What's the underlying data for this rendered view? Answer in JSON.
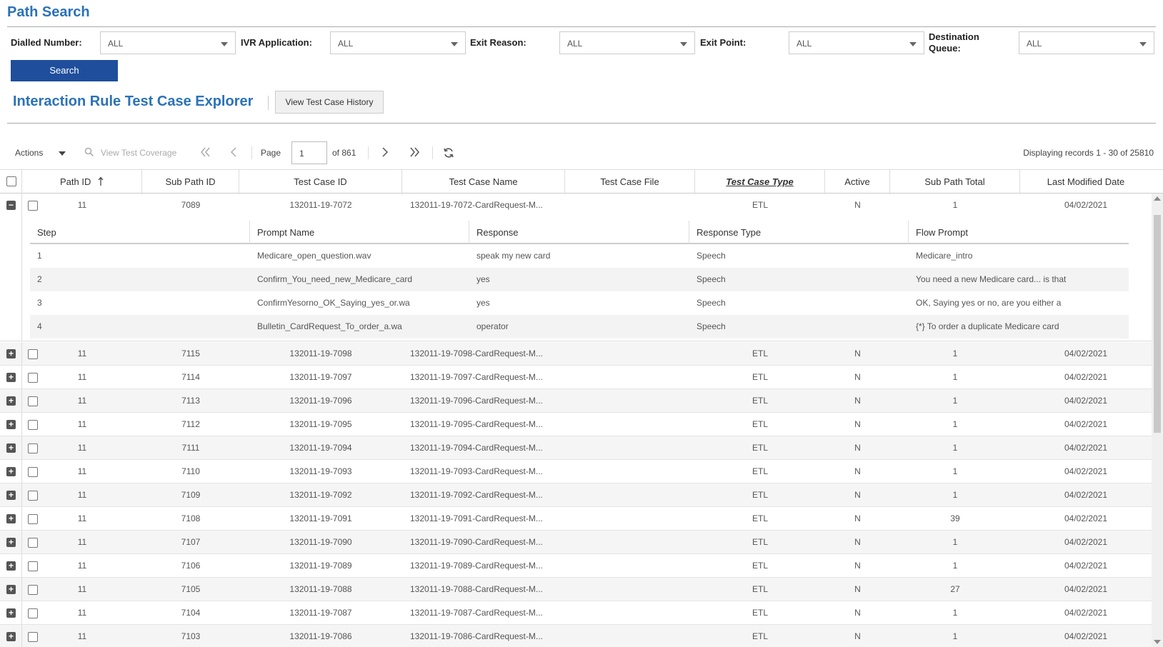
{
  "header": {
    "title": "Path Search"
  },
  "filters": [
    {
      "label": "Dialled Number:",
      "value": "ALL"
    },
    {
      "label": "IVR Application:",
      "value": "ALL"
    },
    {
      "label": "Exit Reason:",
      "value": "ALL"
    },
    {
      "label": "Exit Point:",
      "value": "ALL"
    },
    {
      "label": "Destination Queue:",
      "label_lines": [
        "Destination",
        "Queue:"
      ],
      "value": "ALL"
    }
  ],
  "search_label": "Search",
  "explorer": {
    "title": "Interaction Rule Test Case Explorer",
    "history_label": "View Test Case History"
  },
  "toolbar": {
    "actions_label": "Actions",
    "coverage_label": "View Test Coverage",
    "page_label": "Page",
    "page_value": "1",
    "of_label": "of 861",
    "records_label": "Displaying records 1 - 30 of 25810"
  },
  "grid": {
    "columns": [
      "Path ID",
      "Sub Path ID",
      "Test Case ID",
      "Test Case Name",
      "Test Case File",
      "Test Case Type",
      "Active",
      "Sub Path Total",
      "Last Modified Date"
    ],
    "expanded_row": {
      "path_id": "11",
      "sub_path_id": "7089",
      "test_case_id": "132011-19-7072",
      "name": "132011-19-7072-CardRequest-M...",
      "file": "",
      "type": "ETL",
      "active": "N",
      "total": "1",
      "modified": "04/02/2021"
    },
    "sub_columns": [
      "Step",
      "Prompt Name",
      "Response",
      "Response Type",
      "Flow Prompt"
    ],
    "sub_rows": [
      {
        "step": "1",
        "prompt": "Medicare_open_question.wav",
        "response": "speak my new card",
        "rtype": "Speech",
        "flow": "Medicare_intro"
      },
      {
        "step": "2",
        "prompt": "Confirm_You_need_new_Medicare_card",
        "response": "yes",
        "rtype": "Speech",
        "flow": "You need a new Medicare card... is that"
      },
      {
        "step": "3",
        "prompt": "ConfirmYesorno_OK_Saying_yes_or.wa",
        "response": "yes",
        "rtype": "Speech",
        "flow": "OK, Saying yes or no, are you either a"
      },
      {
        "step": "4",
        "prompt": "Bulletin_CardRequest_To_order_a.wa",
        "response": "operator",
        "rtype": "Speech",
        "flow": "{*} To order a duplicate Medicare card"
      }
    ],
    "rows": [
      {
        "path_id": "11",
        "sub_path_id": "7115",
        "test_case_id": "132011-19-7098",
        "name": "132011-19-7098-CardRequest-M...",
        "file": "",
        "type": "ETL",
        "active": "N",
        "total": "1",
        "modified": "04/02/2021"
      },
      {
        "path_id": "11",
        "sub_path_id": "7114",
        "test_case_id": "132011-19-7097",
        "name": "132011-19-7097-CardRequest-M...",
        "file": "",
        "type": "ETL",
        "active": "N",
        "total": "1",
        "modified": "04/02/2021"
      },
      {
        "path_id": "11",
        "sub_path_id": "7113",
        "test_case_id": "132011-19-7096",
        "name": "132011-19-7096-CardRequest-M...",
        "file": "",
        "type": "ETL",
        "active": "N",
        "total": "1",
        "modified": "04/02/2021"
      },
      {
        "path_id": "11",
        "sub_path_id": "7112",
        "test_case_id": "132011-19-7095",
        "name": "132011-19-7095-CardRequest-M...",
        "file": "",
        "type": "ETL",
        "active": "N",
        "total": "1",
        "modified": "04/02/2021"
      },
      {
        "path_id": "11",
        "sub_path_id": "7111",
        "test_case_id": "132011-19-7094",
        "name": "132011-19-7094-CardRequest-M...",
        "file": "",
        "type": "ETL",
        "active": "N",
        "total": "1",
        "modified": "04/02/2021"
      },
      {
        "path_id": "11",
        "sub_path_id": "7110",
        "test_case_id": "132011-19-7093",
        "name": "132011-19-7093-CardRequest-M...",
        "file": "",
        "type": "ETL",
        "active": "N",
        "total": "1",
        "modified": "04/02/2021"
      },
      {
        "path_id": "11",
        "sub_path_id": "7109",
        "test_case_id": "132011-19-7092",
        "name": "132011-19-7092-CardRequest-M...",
        "file": "",
        "type": "ETL",
        "active": "N",
        "total": "1",
        "modified": "04/02/2021"
      },
      {
        "path_id": "11",
        "sub_path_id": "7108",
        "test_case_id": "132011-19-7091",
        "name": "132011-19-7091-CardRequest-M...",
        "file": "",
        "type": "ETL",
        "active": "N",
        "total": "39",
        "modified": "04/02/2021"
      },
      {
        "path_id": "11",
        "sub_path_id": "7107",
        "test_case_id": "132011-19-7090",
        "name": "132011-19-7090-CardRequest-M...",
        "file": "",
        "type": "ETL",
        "active": "N",
        "total": "1",
        "modified": "04/02/2021"
      },
      {
        "path_id": "11",
        "sub_path_id": "7106",
        "test_case_id": "132011-19-7089",
        "name": "132011-19-7089-CardRequest-M...",
        "file": "",
        "type": "ETL",
        "active": "N",
        "total": "1",
        "modified": "04/02/2021"
      },
      {
        "path_id": "11",
        "sub_path_id": "7105",
        "test_case_id": "132011-19-7088",
        "name": "132011-19-7088-CardRequest-M...",
        "file": "",
        "type": "ETL",
        "active": "N",
        "total": "27",
        "modified": "04/02/2021"
      },
      {
        "path_id": "11",
        "sub_path_id": "7104",
        "test_case_id": "132011-19-7087",
        "name": "132011-19-7087-CardRequest-M...",
        "file": "",
        "type": "ETL",
        "active": "N",
        "total": "1",
        "modified": "04/02/2021"
      },
      {
        "path_id": "11",
        "sub_path_id": "7103",
        "test_case_id": "132011-19-7086",
        "name": "132011-19-7086-CardRequest-M...",
        "file": "",
        "type": "ETL",
        "active": "N",
        "total": "1",
        "modified": "04/02/2021"
      }
    ]
  },
  "colors": {
    "title": "#2b72b8",
    "search_button": "#1f4e9c"
  },
  "icons": {
    "dropdown": "chevron-down-icon",
    "first": "first-page-icon",
    "prev": "prev-page-icon",
    "next": "next-page-icon",
    "last": "last-page-icon",
    "refresh": "refresh-icon",
    "search": "search-icon",
    "sort": "sort-asc-icon",
    "expand": "expand-icon",
    "collapse": "collapse-icon"
  }
}
